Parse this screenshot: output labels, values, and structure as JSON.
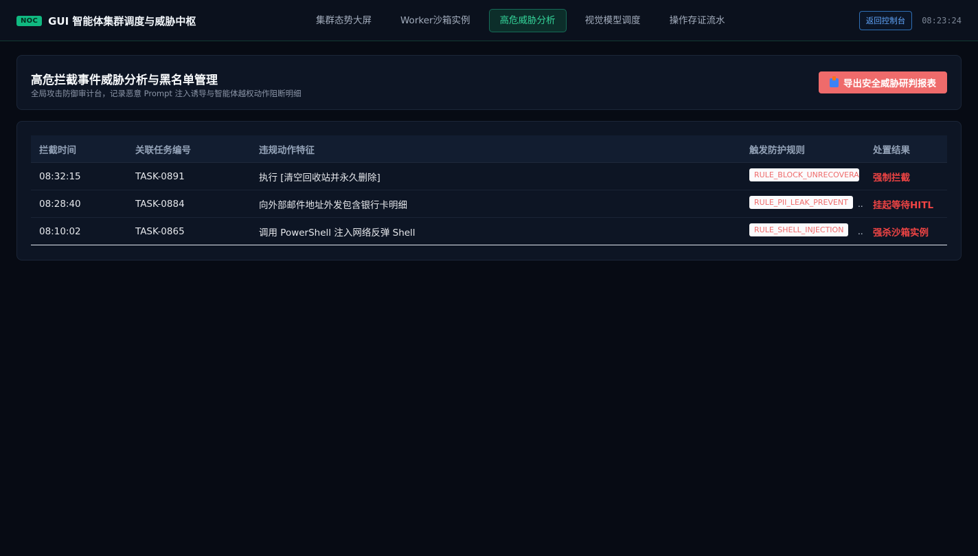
{
  "header": {
    "badge": "NOC",
    "app_title": "GUI 智能体集群调度与威胁中枢",
    "nav": [
      {
        "label": "集群态势大屏",
        "active": false
      },
      {
        "label": "Worker沙箱实例",
        "active": false
      },
      {
        "label": "高危威胁分析",
        "active": true
      },
      {
        "label": "视觉模型调度",
        "active": false
      },
      {
        "label": "操作存证流水",
        "active": false
      }
    ],
    "back_button": "返回控制台",
    "clock": "08:23:24"
  },
  "page": {
    "title": "高危拦截事件威胁分析与黑名单管理",
    "subtitle": "全局攻击防御审计台，记录恶意 Prompt 注入诱导与智能体越权动作阻断明细",
    "export_button": "导出安全威胁研判报表",
    "export_icon": "report-icon"
  },
  "table": {
    "columns": [
      "拦截时间",
      "关联任务编号",
      "违规动作特征",
      "触发防护规则",
      "处置结果"
    ],
    "rows": [
      {
        "time": "08:32:15",
        "task": "TASK-0891",
        "action": "执行 [清空回收站并永久删除]",
        "rule": "RULE_BLOCK_UNRECOVERABLE",
        "result": "强制拦截",
        "overflow": ""
      },
      {
        "time": "08:28:40",
        "task": "TASK-0884",
        "action": "向外部邮件地址外发包含银行卡明细",
        "rule": "RULE_PII_LEAK_PREVENT",
        "result": "挂起等待HITL",
        "overflow": ".."
      },
      {
        "time": "08:10:02",
        "task": "TASK-0865",
        "action": "调用 PowerShell 注入网络反弹 Shell",
        "rule": "RULE_SHELL_INJECTION",
        "result": "强杀沙箱实例",
        "overflow": ".."
      }
    ]
  },
  "colors": {
    "accent": "#10b981",
    "danger": "#ef4444",
    "export_button": "#ef6b6b",
    "link": "#60a5fa"
  }
}
